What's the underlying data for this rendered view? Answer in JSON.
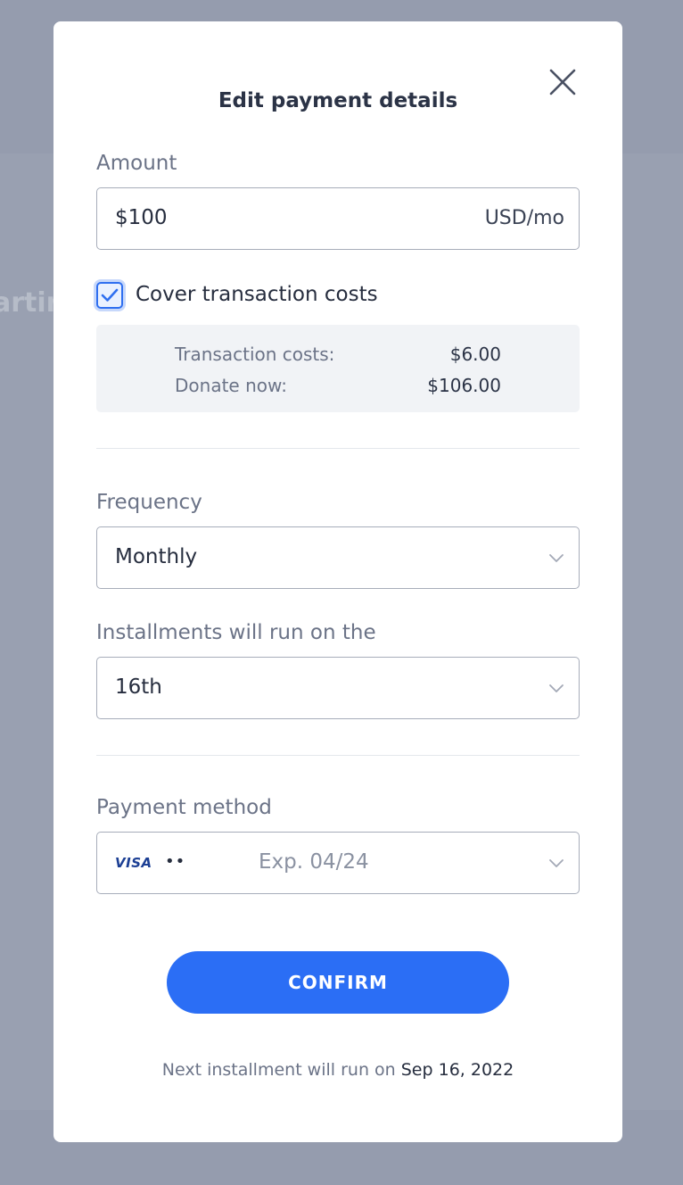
{
  "background": {
    "partial_text": "artir"
  },
  "modal": {
    "title": "Edit payment details",
    "amount": {
      "label": "Amount",
      "value": "$100",
      "suffix": "USD/mo"
    },
    "cover_costs": {
      "label": "Cover transaction costs",
      "checked": true
    },
    "costs": {
      "transaction_label": "Transaction costs:",
      "transaction_value": "$6.00",
      "donate_label": "Donate now:",
      "donate_value": "$106.00"
    },
    "frequency": {
      "label": "Frequency",
      "value": "Monthly"
    },
    "installments": {
      "label": "Installments will run on the",
      "value": "16th"
    },
    "payment_method": {
      "label": "Payment method",
      "brand": "VISA",
      "dots": "••",
      "expiry": "Exp. 04/24"
    },
    "confirm_label": "CONFIRM",
    "next_installment": {
      "prefix": "Next installment will run on",
      "date": "Sep 16, 2022"
    }
  },
  "colors": {
    "accent": "#2b6ef5",
    "overlay": "#959cae"
  }
}
